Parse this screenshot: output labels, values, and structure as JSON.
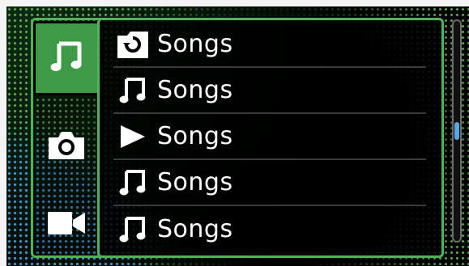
{
  "sidebar": {
    "tabs": [
      {
        "name": "music",
        "icon": "music-note-icon",
        "active": true
      },
      {
        "name": "camera",
        "icon": "camera-icon",
        "active": false
      },
      {
        "name": "video",
        "icon": "video-camera-icon",
        "active": false
      }
    ]
  },
  "list": {
    "items": [
      {
        "icon": "refresh-folder-icon",
        "label": "Songs"
      },
      {
        "icon": "music-note-icon",
        "label": "Songs"
      },
      {
        "icon": "play-icon",
        "label": "Songs"
      },
      {
        "icon": "music-note-icon",
        "label": "Songs"
      },
      {
        "icon": "music-note-icon",
        "label": "Songs"
      }
    ]
  },
  "scrollbar": {
    "position_fraction": 0.5
  },
  "colors": {
    "accent_green": "#4fb35a",
    "active_tab": "#3d9a45",
    "scroll_thumb": "#5aa7e6",
    "text": "#ffffff"
  }
}
